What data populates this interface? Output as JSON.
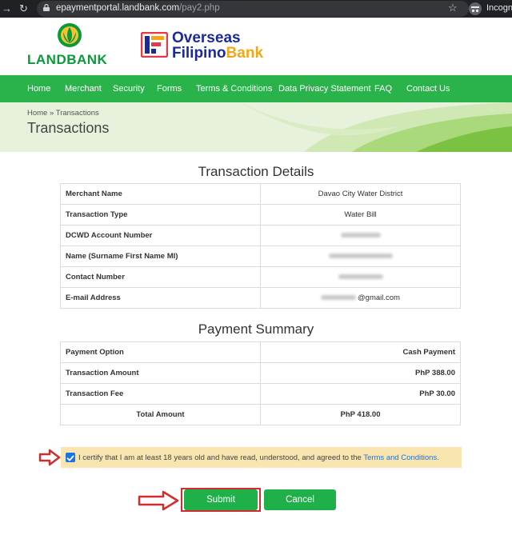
{
  "browser": {
    "url_host": "epaymentportal.landbank.com",
    "url_path": "/pay2.php",
    "incognito_label": "Incognito"
  },
  "header": {
    "landbank_name": "LANDBANK",
    "ofb_line1": "Overseas",
    "ofb_line2_a": "Filipino",
    "ofb_line2_b": "Bank"
  },
  "nav": {
    "items": [
      "Home",
      "Merchant",
      "Security",
      "Forms",
      "Terms & Conditions",
      "Data Privacy Statement",
      "FAQ",
      "Contact Us"
    ]
  },
  "page": {
    "breadcrumb_home": "Home",
    "breadcrumb_sep": "»",
    "breadcrumb_current": "Transactions",
    "title": "Transactions"
  },
  "details": {
    "title": "Transaction Details",
    "rows": [
      {
        "label": "Merchant Name",
        "value": "Davao City Water District"
      },
      {
        "label": "Transaction Type",
        "value": "Water Bill"
      },
      {
        "label": "DCWD Account Number",
        "value": ""
      },
      {
        "label": "Name (Surname First Name MI)",
        "value": ""
      },
      {
        "label": "Contact Number",
        "value": ""
      },
      {
        "label": "E-mail Address",
        "value": "@gmail.com"
      }
    ]
  },
  "payment": {
    "title": "Payment Summary",
    "rows": [
      {
        "label": "Payment Option",
        "value": "Cash Payment"
      },
      {
        "label": "Transaction Amount",
        "value": "PhP 388.00"
      },
      {
        "label": "Transaction Fee",
        "value": "PhP 30.00"
      }
    ],
    "total_label": "Total Amount",
    "total_value": "PhP 418.00"
  },
  "certify": {
    "text": "I certify that I am at least 18 years old and have read, understood, and agreed to the",
    "link": "Terms and Conditions.",
    "checked": true
  },
  "buttons": {
    "submit": "Submit",
    "cancel": "Cancel"
  },
  "colors": {
    "green": "#2bb34b",
    "highlight": "#d42b2b",
    "note_bg": "#f8e5b0"
  }
}
